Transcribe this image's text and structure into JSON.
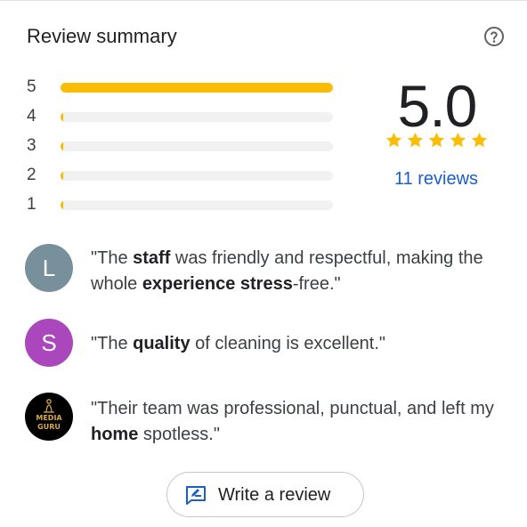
{
  "header": {
    "title": "Review summary",
    "help_icon": "help-circle-icon"
  },
  "distribution": [
    {
      "label": "5",
      "fraction": 1.0
    },
    {
      "label": "4",
      "fraction": 0.0
    },
    {
      "label": "3",
      "fraction": 0.0
    },
    {
      "label": "2",
      "fraction": 0.0
    },
    {
      "label": "1",
      "fraction": 0.0
    }
  ],
  "summary": {
    "score": "5.0",
    "stars_filled": 5,
    "reviews_link": "11 reviews"
  },
  "snippets": [
    {
      "avatar_letter": "L",
      "avatar_color": "#78909c",
      "parts": [
        {
          "t": "\"The "
        },
        {
          "t": "staff",
          "b": true
        },
        {
          "t": " was friendly and respectful, making the whole "
        },
        {
          "t": "experience",
          "b": true
        },
        {
          "t": " "
        },
        {
          "t": "stress",
          "b": true
        },
        {
          "t": "-free.\""
        }
      ]
    },
    {
      "avatar_letter": "S",
      "avatar_color": "#ab47bc",
      "parts": [
        {
          "t": "\"The "
        },
        {
          "t": "quality",
          "b": true
        },
        {
          "t": " of cleaning is excellent.\""
        }
      ]
    },
    {
      "avatar_logo_lines": [
        "MEDIA",
        "GURU"
      ],
      "parts": [
        {
          "t": "\"Their team was professional, punctual, and left my "
        },
        {
          "t": "home",
          "b": true
        },
        {
          "t": " spotless.\""
        }
      ]
    }
  ],
  "actions": {
    "write_review_label": "Write a review",
    "write_review_icon": "rate-review-icon"
  },
  "colors": {
    "bar_fill": "#fbbc04",
    "bar_track": "#f1f1f1",
    "star": "#fbbc04",
    "link": "#1a5fc4",
    "logo_gold": "#d8a84c"
  }
}
